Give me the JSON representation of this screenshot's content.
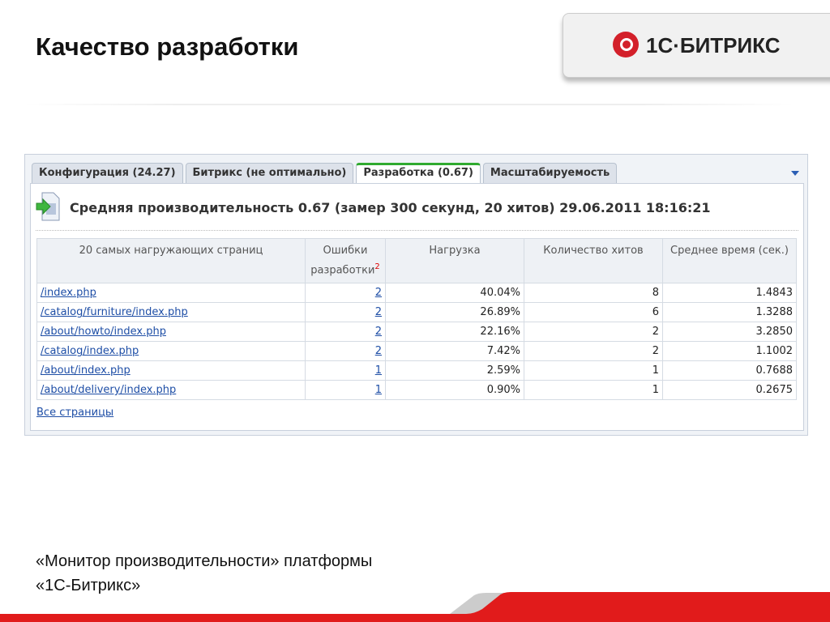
{
  "slide": {
    "title": "Качество разработки",
    "footer_line1": "«Монитор производительности» платформы",
    "footer_line2": "«1С-Битрикс»"
  },
  "logo": {
    "text": "1С·БИТРИКС"
  },
  "tabs": [
    "Конфигурация (24.27)",
    "Битрикс (не оптимально)",
    "Разработка (0.67)",
    "Масштабируемость"
  ],
  "heading": "Средняя производительность 0.67 (замер 300 секунд, 20 хитов) 29.06.2011 18:16:21",
  "table": {
    "headers": [
      "20 самых нагружающих страниц",
      "Ошибки разработки",
      "Нагрузка",
      "Количество хитов",
      "Среднее время (сек.)"
    ],
    "header_sup": "2",
    "rows": [
      [
        "/index.php",
        "2",
        "40.04%",
        "8",
        "1.4843"
      ],
      [
        "/catalog/furniture/index.php",
        "2",
        "26.89%",
        "6",
        "1.3288"
      ],
      [
        "/about/howto/index.php",
        "2",
        "22.16%",
        "2",
        "3.2850"
      ],
      [
        "/catalog/index.php",
        "2",
        "7.42%",
        "2",
        "1.1002"
      ],
      [
        "/about/index.php",
        "1",
        "2.59%",
        "1",
        "0.7688"
      ],
      [
        "/about/delivery/index.php",
        "1",
        "0.90%",
        "1",
        "0.2675"
      ]
    ]
  },
  "all_pages_link": "Все страницы",
  "colors": {
    "accent": "#e11b1b",
    "tab_active": "#2faa2f",
    "link": "#1e4ea6"
  }
}
